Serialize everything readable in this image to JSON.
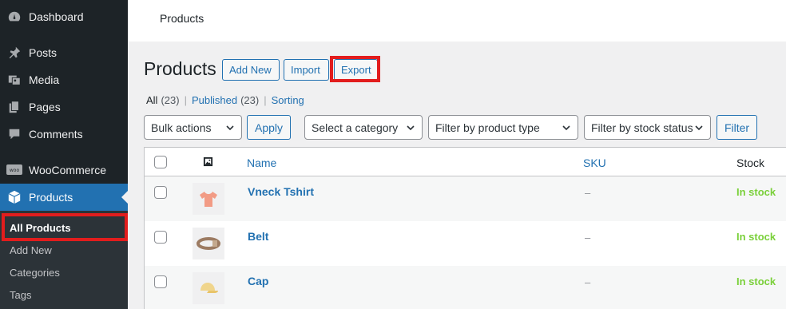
{
  "sidebar": {
    "items": [
      {
        "label": "Dashboard",
        "icon": "dashboard-icon"
      },
      {
        "label": "Posts",
        "icon": "pin-icon"
      },
      {
        "label": "Media",
        "icon": "media-icon"
      },
      {
        "label": "Pages",
        "icon": "pages-icon"
      },
      {
        "label": "Comments",
        "icon": "comment-icon"
      },
      {
        "label": "WooCommerce",
        "icon": "woo-icon"
      },
      {
        "label": "Products",
        "icon": "products-box-icon"
      }
    ],
    "submenu": [
      "All Products",
      "Add New",
      "Categories",
      "Tags"
    ]
  },
  "header": {
    "crumb": "Products"
  },
  "page": {
    "title": "Products",
    "add_new": "Add New",
    "import": "Import",
    "export": "Export"
  },
  "views": {
    "all": "All",
    "all_count": "(23)",
    "published": "Published",
    "published_count": "(23)",
    "sorting": "Sorting"
  },
  "filters": {
    "bulk": "Bulk actions",
    "apply": "Apply",
    "category": "Select a category",
    "product_type": "Filter by product type",
    "stock_status": "Filter by stock status",
    "filter": "Filter"
  },
  "table": {
    "headers": {
      "name": "Name",
      "sku": "SKU",
      "stock": "Stock"
    },
    "rows": [
      {
        "name": "Vneck Tshirt",
        "sku": "–",
        "stock": "In stock",
        "thumb": "tshirt-icon"
      },
      {
        "name": "Belt",
        "sku": "–",
        "stock": "In stock",
        "thumb": "belt-icon"
      },
      {
        "name": "Cap",
        "sku": "–",
        "stock": "In stock",
        "thumb": "cap-icon"
      }
    ]
  },
  "colors": {
    "accent": "#2271b1",
    "highlight": "#e21d1d",
    "in_stock": "#7ad03a",
    "sidebar": "#1d2327"
  }
}
